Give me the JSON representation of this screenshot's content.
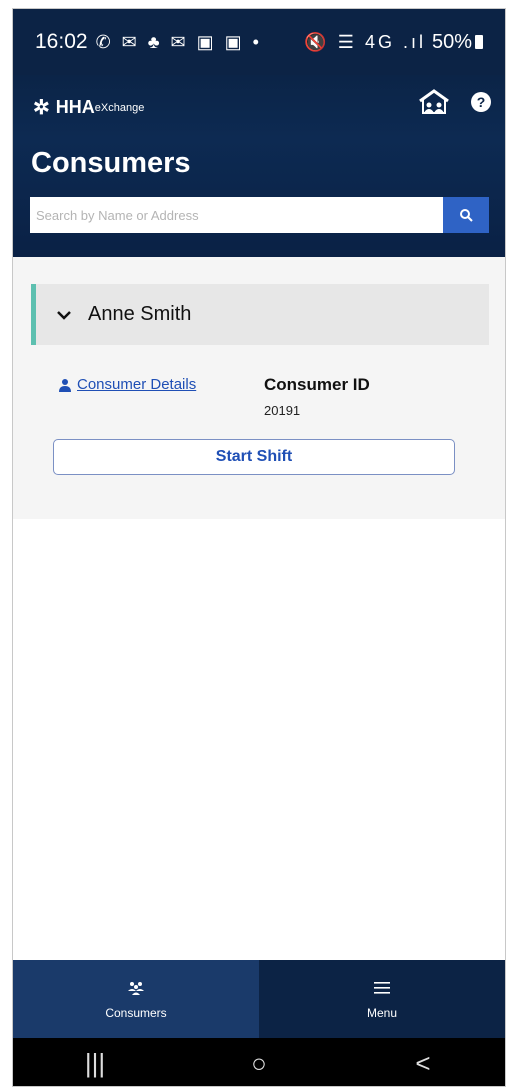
{
  "status_bar": {
    "time": "16:02",
    "notification_icons": "✆ ✉ ♣ ✉ ▣ ▣ •",
    "system_icons": "🔇 ☰ 4G .ıl",
    "battery": "50%"
  },
  "header": {
    "brand_text": "HHA",
    "brand_suffix": "eXchange",
    "title": "Consumers",
    "home_icon": "home-icon",
    "help_icon": "help-icon",
    "help_glyph": "?"
  },
  "search": {
    "placeholder": "Search by Name or Address",
    "value": ""
  },
  "consumer": {
    "name": "Anne Smith",
    "details_link": "Consumer Details",
    "id_label": "Consumer ID",
    "id_value": "20191",
    "start_button": "Start Shift"
  },
  "bottom_nav": {
    "items": [
      {
        "label": "Consumers",
        "icon": "people-icon"
      },
      {
        "label": "Menu",
        "icon": "hamburger-icon"
      }
    ]
  },
  "system_nav": {
    "recents": "|||",
    "home": "○",
    "back": "<"
  },
  "colors": {
    "navy": "#0c2345",
    "accent_blue": "#2f63c5",
    "link_blue": "#1f4fb5",
    "teal": "#5dc0b0"
  }
}
